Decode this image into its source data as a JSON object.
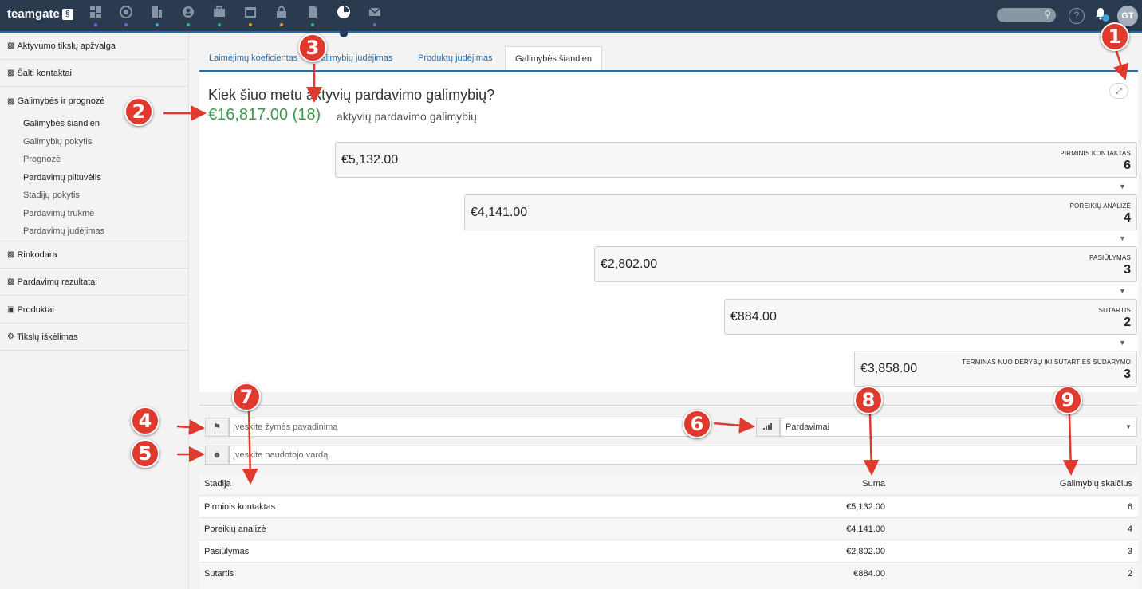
{
  "app": {
    "logo_text": "teamgate",
    "logo_badge": "§",
    "nav_icons": [
      "dashboard-icon",
      "target-icon",
      "building-icon",
      "contacts-icon",
      "briefcase-icon",
      "calendar-icon",
      "lock-icon",
      "notes-icon",
      "reports-icon",
      "mail-icon"
    ],
    "help_label": "?",
    "avatar_initials": "GT"
  },
  "sidebar": {
    "items": [
      {
        "label": "Aktyvumo tikslų apžvalga",
        "icon": "bar-chart-icon"
      },
      {
        "label": "Šalti kontaktai",
        "icon": "bar-chart-icon"
      },
      {
        "label": "Galimybės ir prognozė",
        "icon": "bar-chart-icon"
      },
      {
        "label": "Rinkodara",
        "icon": "bar-chart-icon"
      },
      {
        "label": "Pardavimų rezultatai",
        "icon": "bar-chart-icon"
      },
      {
        "label": "Produktai",
        "icon": "lock-icon"
      },
      {
        "label": "Tikslų iškėlimas",
        "icon": "cogs-icon"
      }
    ],
    "subitems": [
      "Galimybės šiandien",
      "Galimybių pokytis",
      "Prognozė",
      "Pardavimų piltuvėlis",
      "Stadijų pokytis",
      "Pardavimų trukmė",
      "Pardavimų judėjimas"
    ]
  },
  "tabs": [
    {
      "label": "Laimėjimų koeficientas"
    },
    {
      "label": "Galimybių judėjimas"
    },
    {
      "label": "Produktų judėjimas"
    },
    {
      "label": "Galimybės šiandien"
    }
  ],
  "panel": {
    "title": "Kiek šiuo metu aktyvių pardavimo galimybių?",
    "total_amount": "€16,817.00 (18)",
    "total_label": "aktyvių pardavimo galimybių",
    "expand_icon": "expand-icon"
  },
  "funnel": [
    {
      "amount": "€5,132.00",
      "stage": "PIRMINIS KONTAKTAS",
      "count": "6"
    },
    {
      "amount": "€4,141.00",
      "stage": "POREIKIŲ ANALIZĖ",
      "count": "4"
    },
    {
      "amount": "€2,802.00",
      "stage": "PASIŪLYMAS",
      "count": "3"
    },
    {
      "amount": "€884.00",
      "stage": "SUTARTIS",
      "count": "2"
    },
    {
      "amount": "€3,858.00",
      "stage": "TERMINAS NUO DERYBŲ IKI SUTARTIES SUDARYMO",
      "count": "3"
    }
  ],
  "filters": {
    "tag_placeholder": "Įveskite žymės pavadinimą",
    "user_placeholder": "Įveskite naudotojo vardą",
    "type_select_value": "Pardavimai"
  },
  "table": {
    "headers": {
      "stage": "Stadija",
      "sum": "Suma",
      "count": "Galimybių skaičius"
    },
    "rows": [
      {
        "stage": "Pirminis kontaktas",
        "sum": "€5,132.00",
        "count": "6"
      },
      {
        "stage": "Poreikių analizė",
        "sum": "€4,141.00",
        "count": "4"
      },
      {
        "stage": "Pasiūlymas",
        "sum": "€2,802.00",
        "count": "3"
      },
      {
        "stage": "Sutartis",
        "sum": "€884.00",
        "count": "2"
      }
    ]
  },
  "annotations": [
    "1",
    "2",
    "3",
    "4",
    "5",
    "6",
    "7",
    "8",
    "9"
  ],
  "colors": {
    "topbar": "#2a3a4f",
    "accent_blue": "#2b6fa8",
    "amount_green": "#3a9a4a",
    "callout_red": "#e03a2f"
  }
}
